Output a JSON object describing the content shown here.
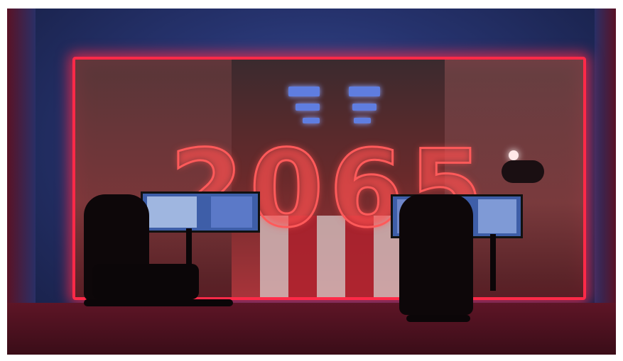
{
  "scene": {
    "neon_text": "2065",
    "colors": {
      "neon": "#ff2a48",
      "wall": "#26336e",
      "floor": "#5e1526"
    }
  }
}
